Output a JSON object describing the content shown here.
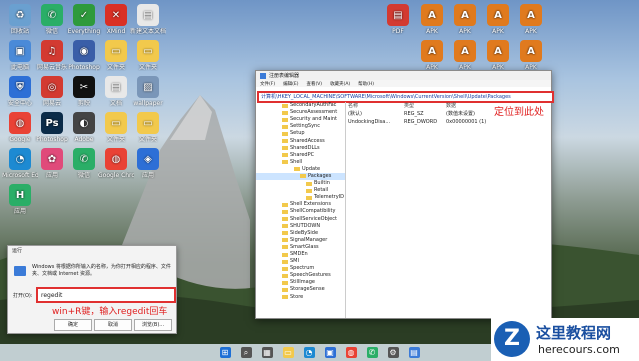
{
  "desktop": {
    "left_icons": [
      {
        "label": "回收站",
        "glyph": "♻",
        "color": "#6aa0d0"
      },
      {
        "label": "微信",
        "glyph": "✆",
        "color": "#2aae67"
      },
      {
        "label": "Everything",
        "glyph": "✓",
        "color": "#2e9a3c"
      },
      {
        "label": "XMind",
        "glyph": "✕",
        "color": "#d93025"
      },
      {
        "label": "新建文本文档",
        "glyph": "▤",
        "color": "#e8e8e8"
      },
      {
        "label": "此电脑",
        "glyph": "▣",
        "color": "#4a8ad8"
      },
      {
        "label": "网易云音乐",
        "glyph": "♫",
        "color": "#d33a31"
      },
      {
        "label": "Photoshop",
        "glyph": "◉",
        "color": "#3a5ea8"
      },
      {
        "label": "文件夹",
        "glyph": "▭",
        "color": "#f2c94c"
      },
      {
        "label": "文件夹",
        "glyph": "▭",
        "color": "#f2c94c"
      },
      {
        "label": "安全中心",
        "glyph": "⛨",
        "color": "#2d6fd6"
      },
      {
        "label": "网易云",
        "glyph": "◎",
        "color": "#d33a31"
      },
      {
        "label": "剪映",
        "glyph": "✂",
        "color": "#111"
      },
      {
        "label": "文档",
        "glyph": "▤",
        "color": "#e8e8e8"
      },
      {
        "label": "wallpaper",
        "glyph": "▨",
        "color": "#7a96b8"
      },
      {
        "label": "Google",
        "glyph": "◍",
        "color": "#e94235"
      },
      {
        "label": "Photoshop",
        "glyph": "Ps",
        "color": "#0b2b48"
      },
      {
        "label": "Adobe",
        "glyph": "◐",
        "color": "#444"
      },
      {
        "label": "文件夹",
        "glyph": "▭",
        "color": "#f2c94c"
      },
      {
        "label": "文件夹",
        "glyph": "▭",
        "color": "#f2c94c"
      },
      {
        "label": "Microsoft Edge",
        "glyph": "◔",
        "color": "#1d8ad2"
      },
      {
        "label": "应用",
        "glyph": "✿",
        "color": "#e04a7a"
      },
      {
        "label": "微信",
        "glyph": "✆",
        "color": "#2aae67"
      },
      {
        "label": "Google Chrome",
        "glyph": "◍",
        "color": "#e94235"
      },
      {
        "label": "应用",
        "glyph": "◈",
        "color": "#2d6fd6"
      },
      {
        "label": "应用",
        "glyph": "H",
        "color": "#2aae67"
      }
    ],
    "right_icons": [
      {
        "label": "PDF",
        "glyph": "▤",
        "color": "#d33a31"
      },
      {
        "label": "APK",
        "glyph": "A",
        "color": "#e07a1e"
      },
      {
        "label": "APK",
        "glyph": "A",
        "color": "#e07a1e"
      },
      {
        "label": "APK",
        "glyph": "A",
        "color": "#e07a1e"
      },
      {
        "label": "APK",
        "glyph": "A",
        "color": "#e07a1e"
      },
      {
        "label": "APK",
        "glyph": "A",
        "color": "#e07a1e"
      },
      {
        "label": "APK",
        "glyph": "A",
        "color": "#e07a1e"
      },
      {
        "label": "APK",
        "glyph": "A",
        "color": "#e07a1e"
      },
      {
        "label": "APK",
        "glyph": "A",
        "color": "#e07a1e"
      },
      {
        "label": "APK",
        "glyph": "A",
        "color": "#e07a1e"
      },
      {
        "label": "APK",
        "glyph": "A",
        "color": "#e07a1e"
      },
      {
        "label": "APK",
        "glyph": "A",
        "color": "#e07a1e"
      },
      {
        "label": "APK",
        "glyph": "A",
        "color": "#e07a1e"
      }
    ]
  },
  "registry": {
    "title": "注册表编辑器",
    "menu": [
      "文件(F)",
      "编辑(E)",
      "查看(V)",
      "收藏夹(A)",
      "帮助(H)"
    ],
    "address": "计算机\\HKEY_LOCAL_MACHINE\\SOFTWARE\\Microsoft\\Windows\\CurrentVersion\\Shell\\Update\\Packages",
    "annotation": "定位到此处",
    "tree": [
      "SecondaryAuthFac",
      "SecureAssessment",
      "Security and Maint",
      "SettingSync",
      "Setup",
      "SharedAccess",
      "SharedDLLs",
      "SharedPC",
      "Shell",
      "Update",
      "Packages",
      "Builtin",
      "Retail",
      "TelemetryID",
      "Shell Extensions",
      "ShellCompatibility",
      "ShellServiceObject",
      "SHUTDOWN",
      "SideBySide",
      "SignalManager",
      "SmartGlass",
      "SMDEn",
      "SMI",
      "Spectrum",
      "SpeechGestures",
      "StillImage",
      "StorageSense",
      "Store"
    ],
    "columns": [
      "名称",
      "类型",
      "数据"
    ],
    "rows": [
      {
        "name": "(默认)",
        "type": "REG_SZ",
        "data": "(数值未设置)"
      },
      {
        "name": "UndockingDisa...",
        "type": "REG_DWORD",
        "data": "0x00000001 (1)"
      }
    ]
  },
  "run": {
    "title": "运行",
    "description": "Windows 将根据你所输入的名称，为你打开相应的程序、文件夹、文档或 Internet 资源。",
    "open_label": "打开(O):",
    "value": "regedit",
    "annotation": "win+R键，输入regedit回车",
    "ok": "确定",
    "cancel": "取消",
    "browse": "浏览(B)..."
  },
  "taskbar": [
    {
      "glyph": "⊞",
      "color": "#1d6fd6"
    },
    {
      "glyph": "⌕",
      "color": "#555"
    },
    {
      "glyph": "▦",
      "color": "#555"
    },
    {
      "glyph": "▭",
      "color": "#f2c94c"
    },
    {
      "glyph": "◔",
      "color": "#1d8ad2"
    },
    {
      "glyph": "▣",
      "color": "#2d6fd6"
    },
    {
      "glyph": "◍",
      "color": "#e94235"
    },
    {
      "glyph": "✆",
      "color": "#2aae67"
    },
    {
      "glyph": "⚙",
      "color": "#555"
    },
    {
      "glyph": "▤",
      "color": "#3b7bd8"
    }
  ],
  "watermark": {
    "logo": "Z",
    "title": "这里教程网",
    "url": "herecours.com"
  }
}
